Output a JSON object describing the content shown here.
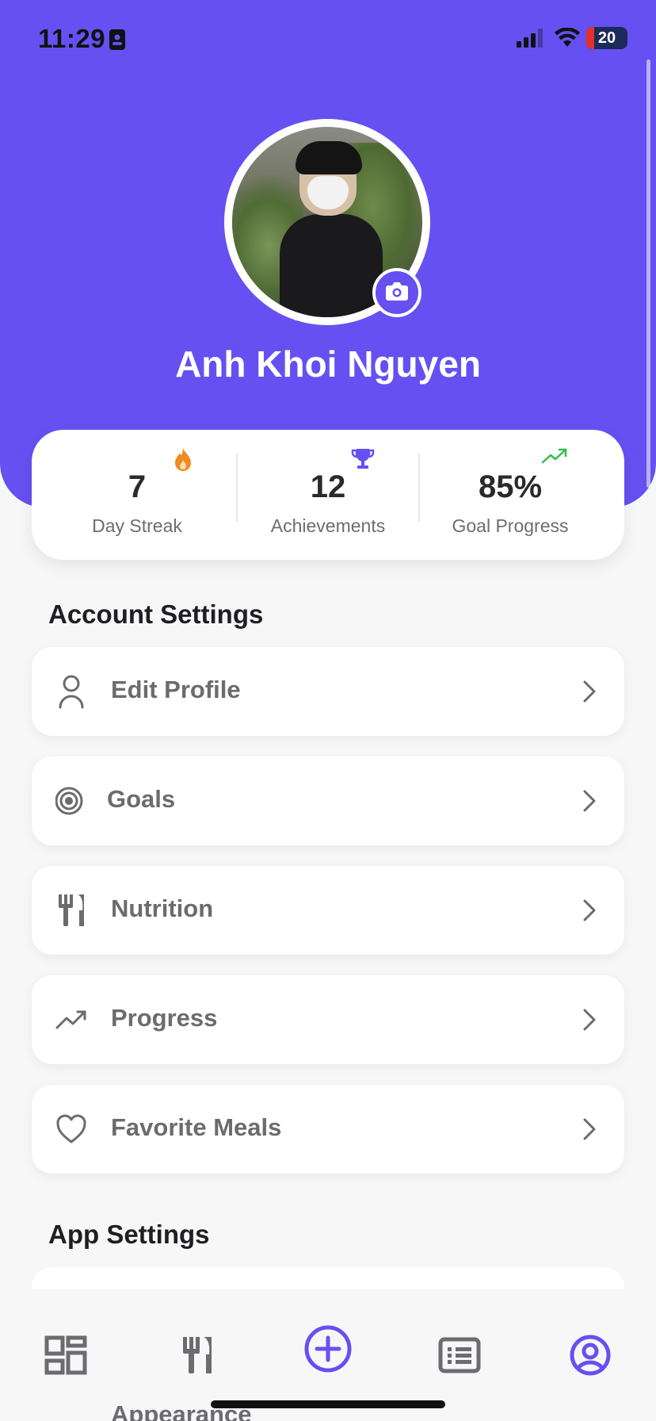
{
  "status_bar": {
    "time": "11:29",
    "battery": "20",
    "battery_level_percent": 20
  },
  "profile": {
    "name": "Anh Khoi Nguyen"
  },
  "stats": [
    {
      "value": "7",
      "label": "Day Streak",
      "icon": "flame-icon",
      "icon_color": "#f08a24"
    },
    {
      "value": "12",
      "label": "Achievements",
      "icon": "trophy-icon",
      "icon_color": "#6650f2"
    },
    {
      "value": "85%",
      "label": "Goal Progress",
      "icon": "trending-up-icon",
      "icon_color": "#2fbf4a"
    }
  ],
  "account_settings": {
    "title": "Account Settings",
    "items": [
      {
        "label": "Edit Profile",
        "icon": "user-icon"
      },
      {
        "label": "Goals",
        "icon": "target-icon"
      },
      {
        "label": "Nutrition",
        "icon": "fork-knife-icon"
      },
      {
        "label": "Progress",
        "icon": "trending-up-icon"
      },
      {
        "label": "Favorite Meals",
        "icon": "heart-icon"
      }
    ]
  },
  "app_settings": {
    "title": "App Settings",
    "items": [
      {
        "label": "Appearance",
        "icon": "theme-icon"
      }
    ]
  },
  "bottom_nav": {
    "items": [
      {
        "icon": "dashboard-icon",
        "active": false
      },
      {
        "icon": "fork-knife-icon",
        "active": false
      },
      {
        "icon": "add-circle-icon",
        "active": true
      },
      {
        "icon": "list-icon",
        "active": false
      },
      {
        "icon": "profile-icon",
        "active": true
      }
    ]
  },
  "colors": {
    "primary": "#6650f2",
    "background": "#f7f7f8",
    "text_muted": "#6b6b70"
  }
}
